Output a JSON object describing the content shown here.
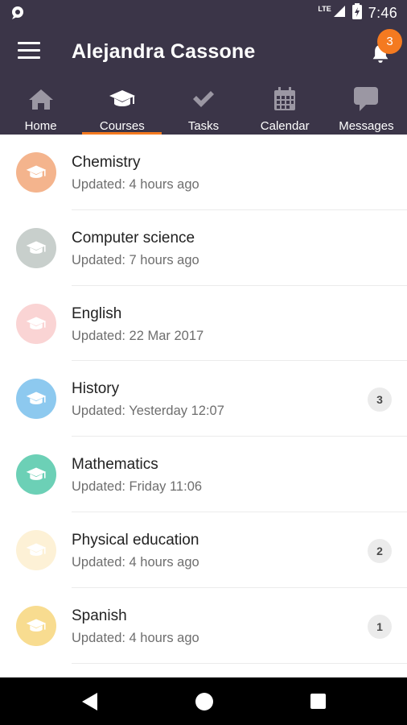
{
  "status_bar": {
    "network_label": "LTE",
    "time": "7:46",
    "icons": [
      "app-notification-icon",
      "signal-icon",
      "battery-icon"
    ]
  },
  "app_bar": {
    "title": "Alejandra Cassone",
    "notification_count": "3",
    "accent_color": "#f47a20",
    "background_color": "#3b3548"
  },
  "tabs": [
    {
      "label": "Home",
      "icon": "home-icon",
      "active": false
    },
    {
      "label": "Courses",
      "icon": "graduation-cap-icon",
      "active": true
    },
    {
      "label": "Tasks",
      "icon": "checkmark-icon",
      "active": false
    },
    {
      "label": "Calendar",
      "icon": "calendar-icon",
      "active": false
    },
    {
      "label": "Messages",
      "icon": "chat-bubble-icon",
      "active": false
    }
  ],
  "courses": [
    {
      "name": "Chemistry",
      "updated": "Updated: 4 hours ago",
      "color": "#f4b48d",
      "unread": ""
    },
    {
      "name": "Computer science",
      "updated": "Updated: 7 hours ago",
      "color": "#c8cfcc",
      "unread": ""
    },
    {
      "name": "English",
      "updated": "Updated: 22 Mar 2017",
      "color": "#fad4d4",
      "unread": ""
    },
    {
      "name": "History",
      "updated": "Updated: Yesterday 12:07",
      "color": "#8dc9ef",
      "unread": "3"
    },
    {
      "name": "Mathematics",
      "updated": "Updated: Friday 11:06",
      "color": "#6cd0b6",
      "unread": ""
    },
    {
      "name": "Physical education",
      "updated": "Updated: 4 hours ago",
      "color": "#fdf1d6",
      "unread": "2"
    },
    {
      "name": "Spanish",
      "updated": "Updated: 4 hours ago",
      "color": "#f8dc90",
      "unread": "1"
    }
  ],
  "nav_bar": {
    "icons": [
      "back-icon",
      "home-circle-icon",
      "recents-square-icon"
    ]
  }
}
